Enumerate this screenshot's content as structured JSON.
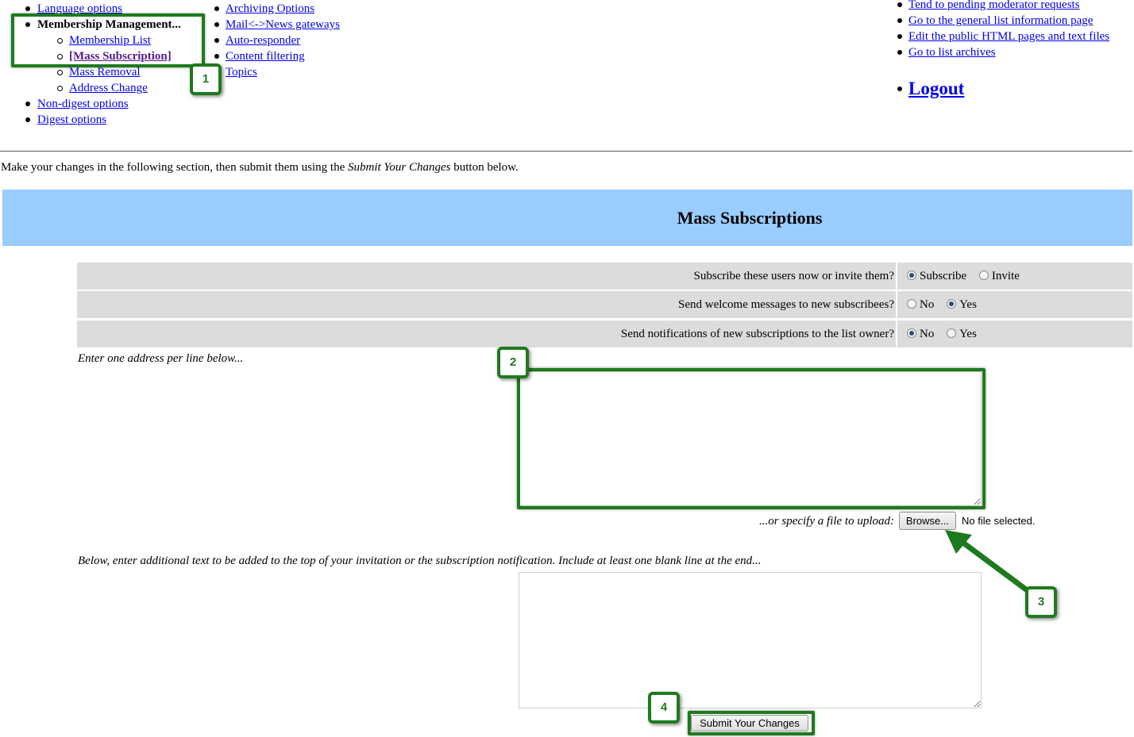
{
  "nav": {
    "col1": {
      "language_options": "Language options",
      "membership_management": "Membership Management...",
      "membership_list": "Membership List",
      "mass_subscription": "[Mass Subscription]",
      "mass_removal": "Mass Removal",
      "address_change": "Address Change",
      "non_digest": "Non-digest options",
      "digest": "Digest options"
    },
    "col2": {
      "archiving": "Archiving Options",
      "mail_news": "Mail<->News gateways",
      "auto_responder": "Auto-responder",
      "content_filtering": "Content filtering",
      "topics": "Topics"
    },
    "col3": {
      "pending": "Tend to pending moderator requests",
      "general_info": "Go to the general list information page",
      "edit_html": "Edit the public HTML pages and text files",
      "archives": "Go to list archives",
      "logout": "Logout"
    }
  },
  "instructions": {
    "before": "Make your changes in the following section, then submit them using the ",
    "emphasis": "Submit Your Changes",
    "after": " button below."
  },
  "section_title": "Mass Subscriptions",
  "rows": [
    {
      "question": "Subscribe these users now or invite them?",
      "options": [
        "Subscribe",
        "Invite"
      ],
      "selected": "Subscribe"
    },
    {
      "question": "Send welcome messages to new subscribees?",
      "options": [
        "No",
        "Yes"
      ],
      "selected": "Yes"
    },
    {
      "question": "Send notifications of new subscriptions to the list owner?",
      "options": [
        "No",
        "Yes"
      ],
      "selected": "No"
    }
  ],
  "addresses_label": "Enter one address per line below...",
  "addresses_value": "",
  "upload_label": "...or specify a file to upload:",
  "browse_label": "Browse...",
  "no_file": "No file selected.",
  "invite_text_label": "Below, enter additional text to be added to the top of your invitation or the subscription notification. Include at least one blank line at the end...",
  "invite_text_value": "",
  "submit_label": "Submit Your Changes",
  "annotations": [
    "1",
    "2",
    "3",
    "4"
  ],
  "colors": {
    "annotation": "#1e7a1e",
    "banner": "#99ccff",
    "row_bg": "#dcdcdc",
    "link": "#0000ee",
    "visited": "#551a8b"
  }
}
